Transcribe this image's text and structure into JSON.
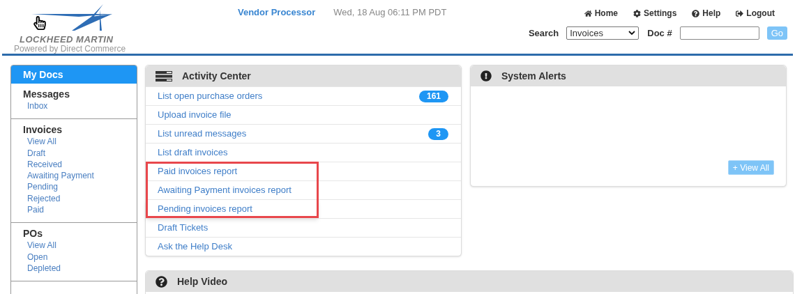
{
  "logo": {
    "wordmark": "LOCKHEED MARTIN",
    "tagline": "Powered by Direct Commerce"
  },
  "header": {
    "app_name": "Vendor Processor",
    "datetime": "Wed, 18 Aug 06:11 PM PDT"
  },
  "top_links": [
    {
      "kind": "home",
      "label": "Home"
    },
    {
      "kind": "settings",
      "label": "Settings"
    },
    {
      "kind": "help",
      "label": "Help"
    },
    {
      "kind": "logout",
      "label": "Logout"
    }
  ],
  "search": {
    "label": "Search",
    "value": "Invoices",
    "doc_label": "Doc #",
    "button": "Go"
  },
  "sidebar": {
    "title": "My Docs",
    "sections": [
      {
        "heading": "Messages",
        "items": [
          "Inbox"
        ]
      },
      {
        "heading": "Invoices",
        "items": [
          "View All",
          "Draft",
          "Received",
          "Awaiting Payment",
          "Pending",
          "Rejected",
          "Paid"
        ]
      },
      {
        "heading": "POs",
        "items": [
          "View All",
          "Open",
          "Depleted"
        ]
      }
    ]
  },
  "activity_center": {
    "title": "Activity Center",
    "items": [
      {
        "label": "List open purchase orders",
        "badge": "161",
        "highlighted": false
      },
      {
        "label": "Upload invoice file",
        "highlighted": false
      },
      {
        "label": "List unread messages",
        "badge": "3",
        "highlighted": false
      },
      {
        "label": "List draft invoices",
        "highlighted": false
      },
      {
        "label": "Paid invoices report",
        "highlighted": true
      },
      {
        "label": "Awaiting Payment invoices report",
        "highlighted": true
      },
      {
        "label": "Pending invoices report",
        "highlighted": true
      },
      {
        "label": "Draft Tickets",
        "highlighted": false
      },
      {
        "label": "Ask the Help Desk",
        "highlighted": false
      }
    ]
  },
  "system_alerts": {
    "title": "System Alerts",
    "button": "+ View All"
  },
  "help_video": {
    "title": "Help Video"
  }
}
